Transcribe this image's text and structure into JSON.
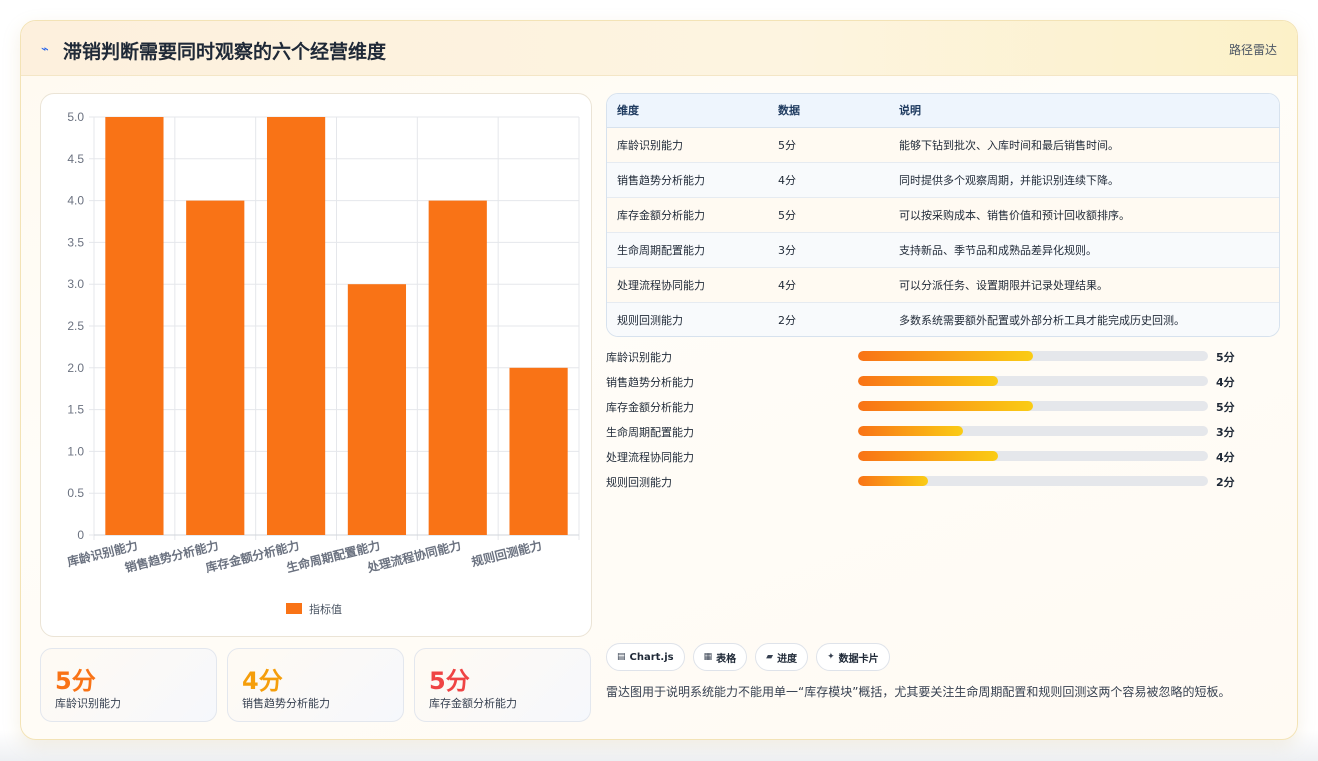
{
  "header": {
    "icon": "trend-icon",
    "title": "滞销判断需要同时观察的六个经营维度",
    "tag": "路径雷达"
  },
  "chart_data": {
    "type": "bar",
    "categories": [
      "库龄识别能力",
      "销售趋势分析能力",
      "库存金额分析能力",
      "生命周期配置能力",
      "处理流程协同能力",
      "规则回测能力"
    ],
    "series": [
      {
        "name": "指标值",
        "values": [
          5,
          4,
          5,
          3,
          4,
          2
        ],
        "color": "#f97316"
      }
    ],
    "yticks": [
      "0",
      "0.5",
      "1.0",
      "1.5",
      "2.0",
      "2.5",
      "3.0",
      "3.5",
      "4.0",
      "4.5",
      "5.0"
    ],
    "ylim": [
      0,
      5
    ],
    "grid": true,
    "legend": "bottom"
  },
  "stat_cards": [
    {
      "value": "5分",
      "label": "库龄识别能力",
      "color": "#f97316"
    },
    {
      "value": "4分",
      "label": "销售趋势分析能力",
      "color": "#f59e0b"
    },
    {
      "value": "5分",
      "label": "库存金额分析能力",
      "color": "#ef4444"
    }
  ],
  "table": {
    "headers": [
      "维度",
      "数据",
      "说明"
    ],
    "rows": [
      [
        "库龄识别能力",
        "5分",
        "能够下钻到批次、入库时间和最后销售时间。"
      ],
      [
        "销售趋势分析能力",
        "4分",
        "同时提供多个观察周期，并能识别连续下降。"
      ],
      [
        "库存金额分析能力",
        "5分",
        "可以按采购成本、销售价值和预计回收额排序。"
      ],
      [
        "生命周期配置能力",
        "3分",
        "支持新品、季节品和成熟品差异化规则。"
      ],
      [
        "处理流程协同能力",
        "4分",
        "可以分派任务、设置期限并记录处理结果。"
      ],
      [
        "规则回测能力",
        "2分",
        "多数系统需要额外配置或外部分析工具才能完成历史回测。"
      ]
    ]
  },
  "progress": [
    {
      "label": "库龄识别能力",
      "value": "5分",
      "fraction": 0.5
    },
    {
      "label": "销售趋势分析能力",
      "value": "4分",
      "fraction": 0.4
    },
    {
      "label": "库存金额分析能力",
      "value": "5分",
      "fraction": 0.5
    },
    {
      "label": "生命周期配置能力",
      "value": "3分",
      "fraction": 0.3
    },
    {
      "label": "处理流程协同能力",
      "value": "4分",
      "fraction": 0.4
    },
    {
      "label": "规则回测能力",
      "value": "2分",
      "fraction": 0.2
    }
  ],
  "chips": [
    {
      "icon": "chart-icon",
      "glyph": "▤",
      "label": "Chart.js"
    },
    {
      "icon": "table-icon",
      "glyph": "▦",
      "label": "表格"
    },
    {
      "icon": "progress-icon",
      "glyph": "▰",
      "label": "进度"
    },
    {
      "icon": "card-icon",
      "glyph": "✦",
      "label": "数据卡片"
    }
  ],
  "note": "雷达图用于说明系统能力不能用单一“库存模块”概括，尤其要关注生命周期配置和规则回测这两个容易被忽略的短板。"
}
